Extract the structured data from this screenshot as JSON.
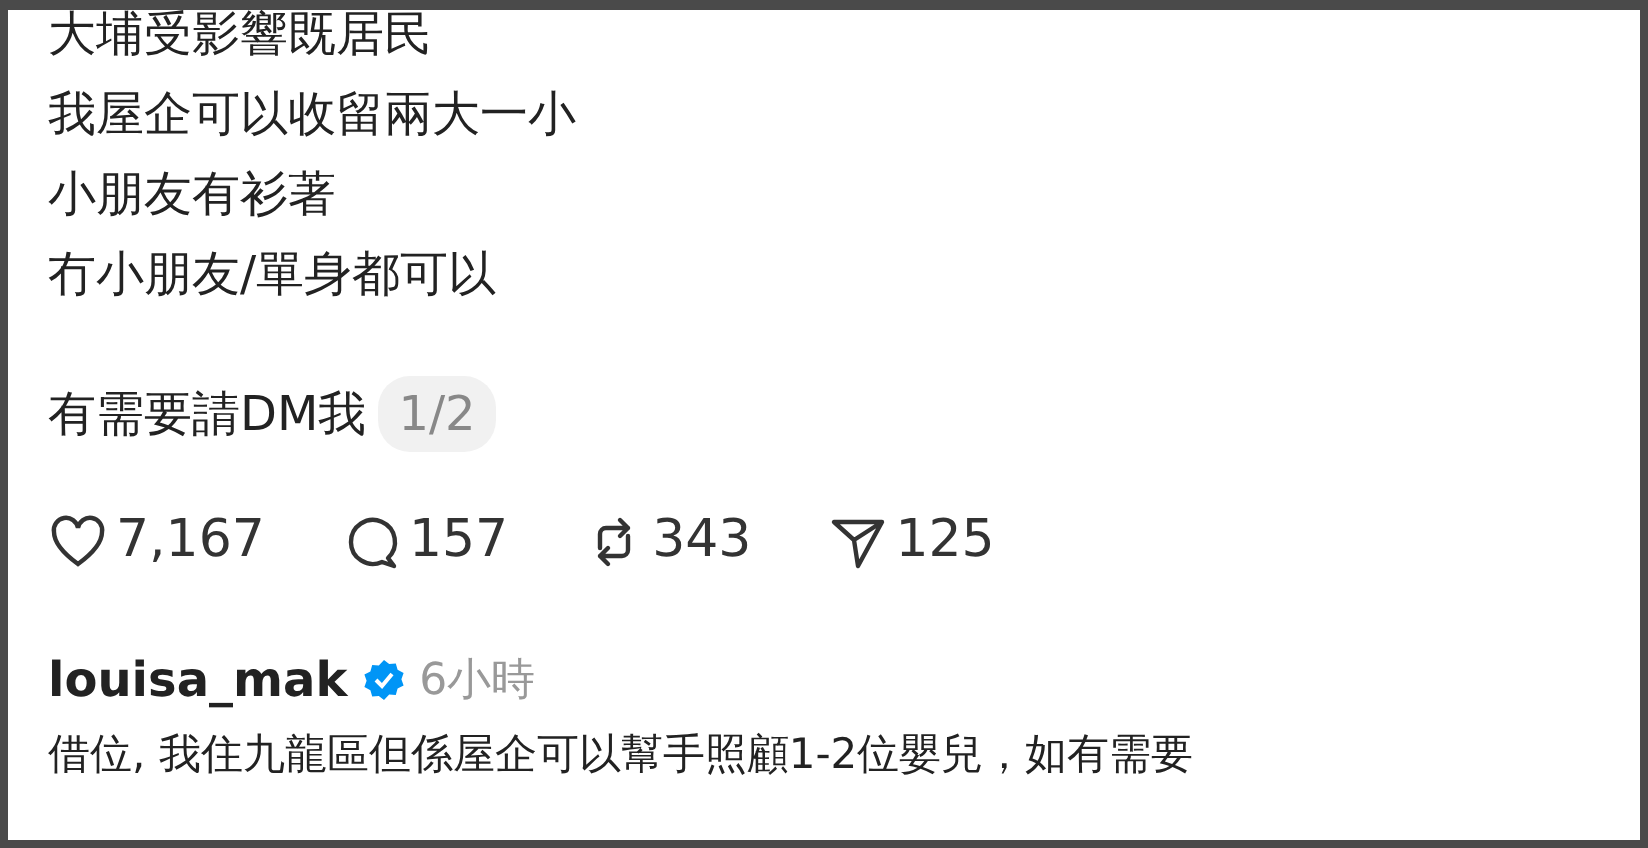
{
  "post": {
    "lines": [
      {
        "text": "大埔受影響既居民",
        "kind": "line"
      },
      {
        "text": "我屋企可以收留兩大一小",
        "kind": "line"
      },
      {
        "text": "小朋友有衫著",
        "kind": "line"
      },
      {
        "text": "冇小朋友/單身都可以",
        "kind": "line"
      },
      {
        "text": "有需要請DM我",
        "kind": "last"
      }
    ],
    "page_indicator": "1/2",
    "actions": [
      {
        "kind": "like",
        "count": "7,167"
      },
      {
        "kind": "comment",
        "count": "157"
      },
      {
        "kind": "repost",
        "count": "343"
      },
      {
        "kind": "share",
        "count": "125"
      }
    ]
  },
  "reply": {
    "username": "louisa_mak",
    "verified": true,
    "time": "6小時",
    "text": "借位, 我住九龍區但係屋企可以幫手照顧1-2位嬰兒，如有需要"
  }
}
